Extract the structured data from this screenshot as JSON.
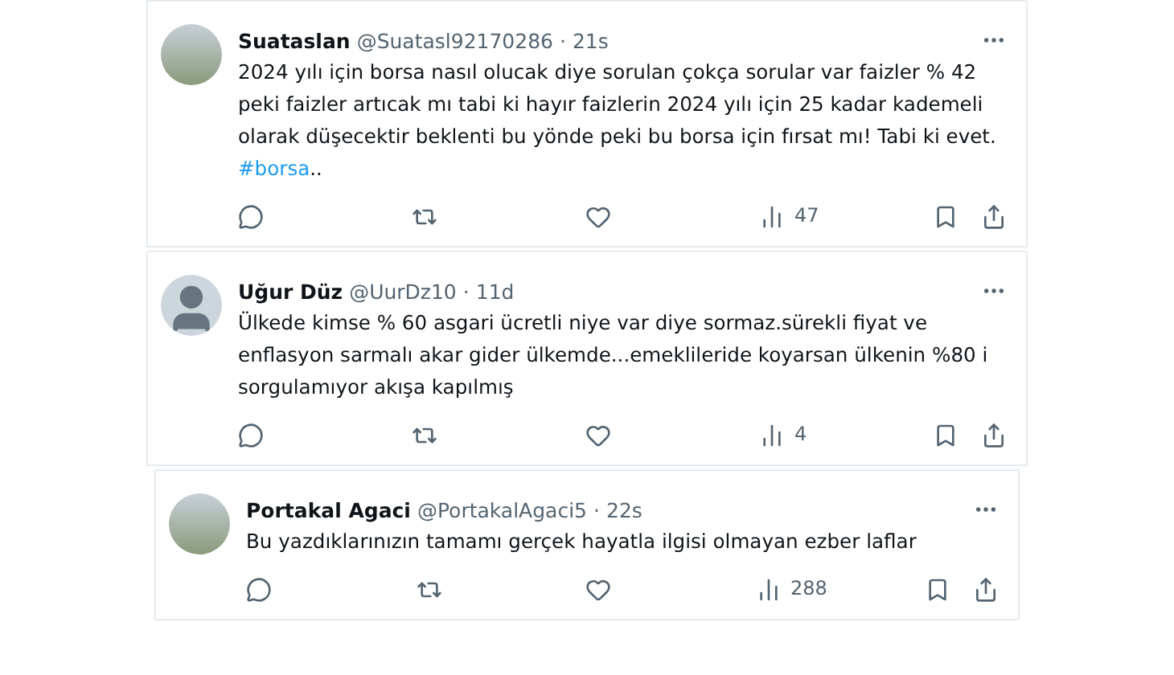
{
  "tweets": [
    {
      "avatar": {
        "kind": "photo"
      },
      "name": "Suataslan",
      "handle": "@Suatasl92170286",
      "time": "21s",
      "separator": "·",
      "body": [
        {
          "kind": "text",
          "text": "2024 yılı için borsa nasıl olucak diye sorulan çokça sorular var faizler % 42 peki faizler artıcak mı tabi ki hayır faizlerin 2024 yılı için 25 kadar kademeli olarak düşecektir beklenti bu yönde peki bu borsa için fırsat mı! Tabi ki evet. "
        },
        {
          "kind": "hashtag",
          "text": "#borsa"
        },
        {
          "kind": "text",
          "text": ".."
        }
      ],
      "views": "47"
    },
    {
      "avatar": {
        "kind": "default"
      },
      "name": "Uğur Düz",
      "handle": "@UurDz10",
      "time": "11d",
      "separator": "·",
      "body": [
        {
          "kind": "text",
          "text": "Ülkede kimse % 60 asgari ücretli niye var diye sormaz.sürekli fiyat ve enflasyon sarmalı akar gider ülkemde...emeklileride koyarsan ülkenin %80 i sorgulamıyor akışa kapılmış"
        }
      ],
      "views": "4"
    },
    {
      "avatar": {
        "kind": "photo"
      },
      "name": "Portakal Agaci",
      "handle": "@PortakalAgaci5",
      "time": "22s",
      "separator": "·",
      "body": [
        {
          "kind": "text",
          "text": "Bu yazdıklarınızın tamamı gerçek hayatla ilgisi olmayan ezber laflar"
        }
      ],
      "views": "288"
    }
  ]
}
